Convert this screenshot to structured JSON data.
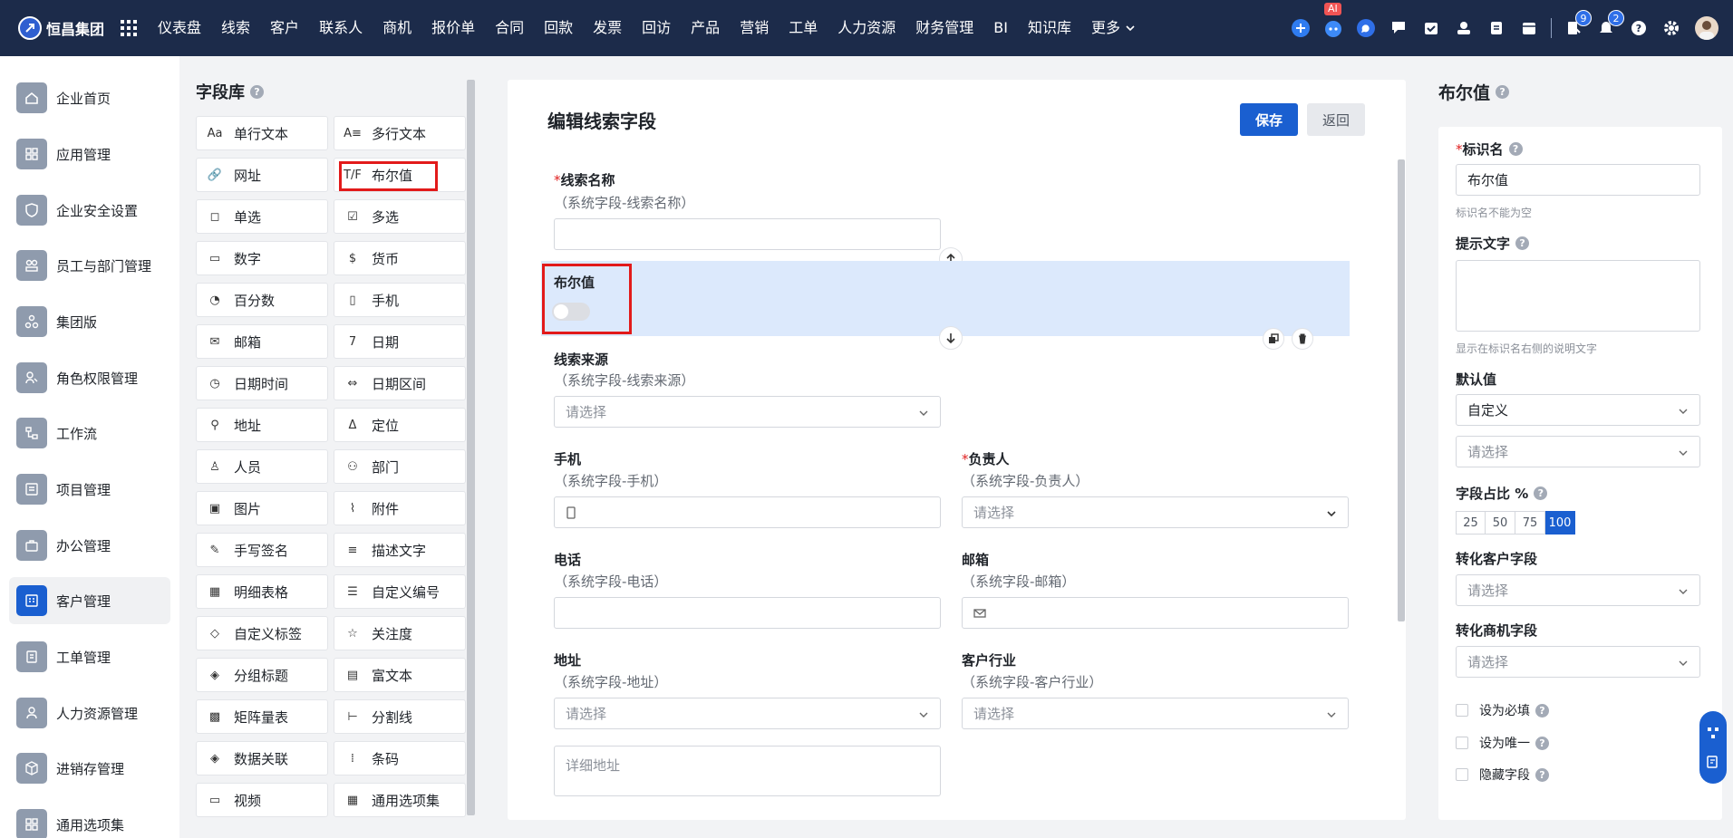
{
  "brand": {
    "name": "恒昌集团"
  },
  "nav": {
    "items": [
      "仪表盘",
      "线索",
      "客户",
      "联系人",
      "商机",
      "报价单",
      "合同",
      "回款",
      "发票",
      "回访",
      "产品",
      "营销",
      "工单",
      "人力资源",
      "财务管理",
      "BI",
      "知识库"
    ],
    "more": "更多"
  },
  "topicons": {
    "ai_label": "AI",
    "notice_count": "9",
    "bell_count": "2"
  },
  "sidebar": {
    "items": [
      "企业首页",
      "应用管理",
      "企业安全设置",
      "员工与部门管理",
      "集团版",
      "角色权限管理",
      "工作流",
      "项目管理",
      "办公管理",
      "客户管理",
      "工单管理",
      "人力资源管理",
      "进销存管理",
      "通用选项集"
    ],
    "active": "客户管理"
  },
  "fieldlib": {
    "title": "字段库",
    "fields": [
      {
        "icon": "Aa",
        "label": "单行文本"
      },
      {
        "icon": "A≡",
        "label": "多行文本"
      },
      {
        "icon": "link",
        "label": "网址"
      },
      {
        "icon": "T/F",
        "label": "布尔值"
      },
      {
        "icon": "radio",
        "label": "单选"
      },
      {
        "icon": "check",
        "label": "多选"
      },
      {
        "icon": "123",
        "label": "数字"
      },
      {
        "icon": "$",
        "label": "货币"
      },
      {
        "icon": "pie",
        "label": "百分数"
      },
      {
        "icon": "phone",
        "label": "手机"
      },
      {
        "icon": "mail",
        "label": "邮箱"
      },
      {
        "icon": "7",
        "label": "日期"
      },
      {
        "icon": "clock",
        "label": "日期时间"
      },
      {
        "icon": "range",
        "label": "日期区间"
      },
      {
        "icon": "pin",
        "label": "地址"
      },
      {
        "icon": "locate",
        "label": "定位"
      },
      {
        "icon": "person",
        "label": "人员"
      },
      {
        "icon": "dept",
        "label": "部门"
      },
      {
        "icon": "image",
        "label": "图片"
      },
      {
        "icon": "clip",
        "label": "附件"
      },
      {
        "icon": "pen",
        "label": "手写签名"
      },
      {
        "icon": "text",
        "label": "描述文字"
      },
      {
        "icon": "table",
        "label": "明细表格"
      },
      {
        "icon": "list",
        "label": "自定义编号"
      },
      {
        "icon": "tag",
        "label": "自定义标签"
      },
      {
        "icon": "star",
        "label": "关注度"
      },
      {
        "icon": "layers",
        "label": "分组标题"
      },
      {
        "icon": "rich",
        "label": "富文本"
      },
      {
        "icon": "matrix",
        "label": "矩阵量表"
      },
      {
        "icon": "divider",
        "label": "分割线"
      },
      {
        "icon": "relate",
        "label": "数据关联"
      },
      {
        "icon": "barcode",
        "label": "条码"
      },
      {
        "icon": "video",
        "label": "视频"
      },
      {
        "icon": "grid",
        "label": "通用选项集"
      }
    ]
  },
  "editor": {
    "title": "编辑线索字段",
    "save": "保存",
    "back": "返回",
    "f_name": {
      "label": "线索名称",
      "sub": "（系统字段-线索名称）"
    },
    "f_bool": {
      "label": "布尔值",
      "value_on": false
    },
    "f_source": {
      "label": "线索来源",
      "sub": "（系统字段-线索来源）",
      "placeholder": "请选择"
    },
    "f_phone": {
      "label": "手机",
      "sub": "（系统字段-手机）"
    },
    "f_owner": {
      "label": "负责人",
      "sub": "（系统字段-负责人）",
      "placeholder": "请选择"
    },
    "f_tel": {
      "label": "电话",
      "sub": "（系统字段-电话）"
    },
    "f_email": {
      "label": "邮箱",
      "sub": "（系统字段-邮箱）"
    },
    "f_addr": {
      "label": "地址",
      "sub": "（系统字段-地址）",
      "placeholder": "请选择",
      "detail_placeholder": "详细地址"
    },
    "f_industry": {
      "label": "客户行业",
      "sub": "（系统字段-客户行业）",
      "placeholder": "请选择"
    }
  },
  "props": {
    "title": "布尔值",
    "name_label": "标识名",
    "name_value": "布尔值",
    "name_hint": "标识名不能为空",
    "tip_label": "提示文字",
    "tip_hint": "显示在标识名右侧的说明文字",
    "default_label": "默认值",
    "default_value": "自定义",
    "default_select": "请选择",
    "ratio_label": "字段占比 %",
    "ratio_options": [
      "25",
      "50",
      "75",
      "100"
    ],
    "ratio_selected": "100",
    "to_customer_label": "转化客户字段",
    "to_customer_select": "请选择",
    "to_opportunity_label": "转化商机字段",
    "to_opportunity_select": "请选择",
    "required_label": "设为必填",
    "unique_label": "设为唯一",
    "hidden_label": "隐藏字段"
  },
  "colors": {
    "topbar": "#1c2b4a",
    "primary": "#1a5fd0",
    "highlight": "#dce9fc",
    "annotation": "#e21a1a"
  }
}
